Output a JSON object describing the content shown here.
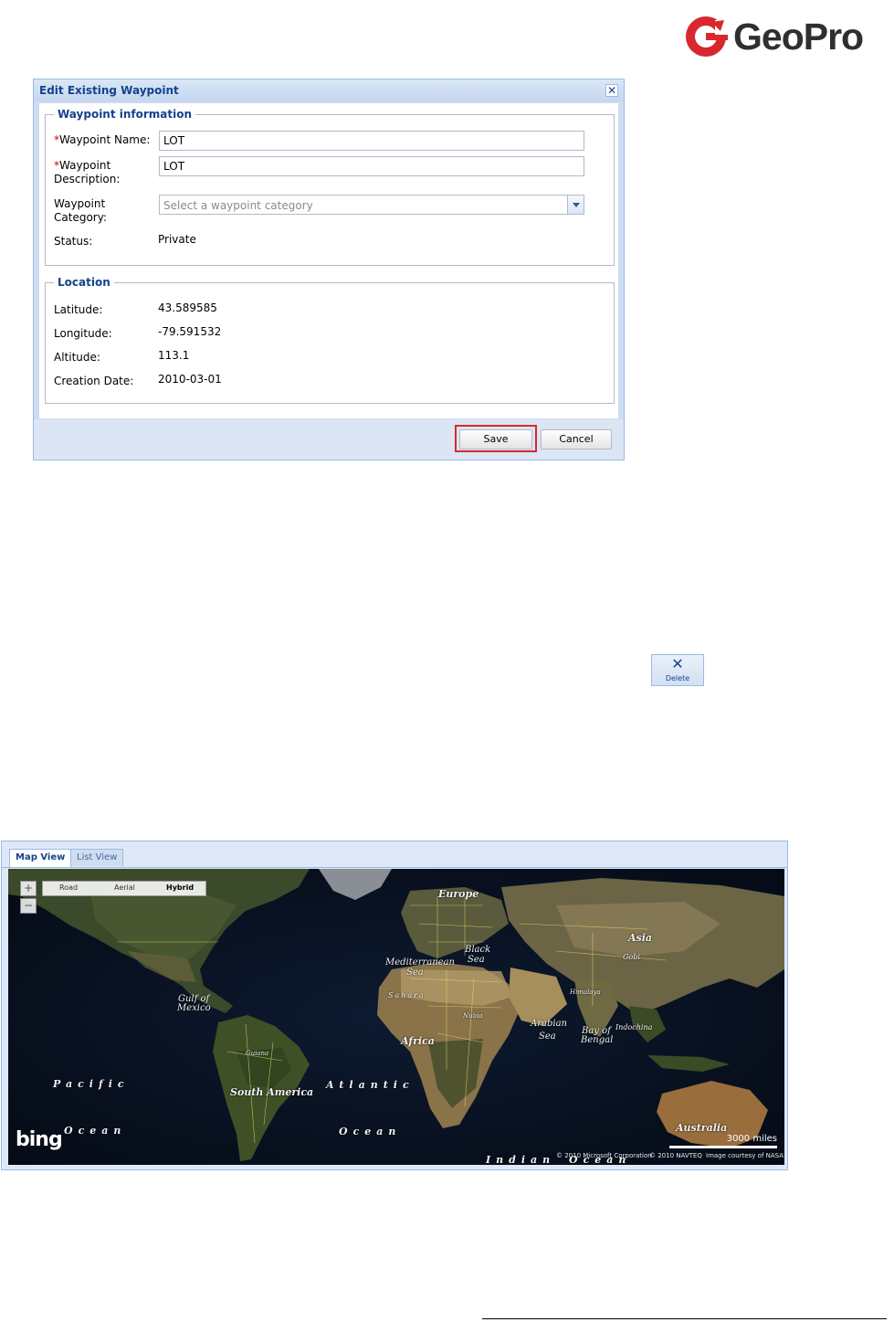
{
  "logo": {
    "text": "GeoPro",
    "color": "#d9272e"
  },
  "dialog": {
    "title": "Edit Existing Waypoint",
    "close_icon": "close-icon",
    "waypoint_section": {
      "legend": "Waypoint information",
      "name_label": "Waypoint Name:",
      "name_value": "LOT",
      "desc_label_1": "Waypoint",
      "desc_label_2": "Description:",
      "desc_value": "LOT",
      "cat_label_1": "Waypoint",
      "cat_label_2": "Category:",
      "cat_placeholder": "Select a waypoint category",
      "status_label": "Status:",
      "status_value": "Private"
    },
    "location_section": {
      "legend": "Location",
      "latitude_label": "Latitude:",
      "latitude_value": "43.589585",
      "longitude_label": "Longitude:",
      "longitude_value": "-79.591532",
      "altitude_label": "Altitude:",
      "altitude_value": "113.1",
      "date_label": "Creation Date:",
      "date_value": "2010-03-01"
    },
    "save_label": "Save",
    "cancel_label": "Cancel",
    "highlight_color": "#d9272e"
  },
  "delete_button": {
    "icon": "x-icon",
    "label": "Delete"
  },
  "map_panel": {
    "tabs": [
      {
        "label": "Map View",
        "active": true
      },
      {
        "label": "List View",
        "active": false
      }
    ],
    "map_styles": {
      "road": "Road",
      "aerial": "Aerial",
      "hybrid": "Hybrid",
      "selected": "Hybrid"
    },
    "zoom_in": "+",
    "zoom_out": "−",
    "labels": {
      "europe": "Europe",
      "asia": "Asia",
      "gobi": "Gobi",
      "black_sea_1": "Black",
      "black_sea_2": "Sea",
      "med_1": "Mediterranean",
      "med_2": "Sea",
      "sahara": "Sahara",
      "himalaya": "Himalaya",
      "nubia": "Nubia",
      "gulf_1": "Gulf of",
      "gulf_2": "Mexico",
      "africa": "Africa",
      "arabian_1": "Arabian",
      "arabian_2": "Sea",
      "bengal_1": "Bay of",
      "bengal_2": "Bengal",
      "indochina": "Indochina",
      "guiana": "Guiana",
      "south_america": "South America",
      "pacific": "Pacific",
      "atlantic": "Atlantic",
      "ocean_1": "Ocean",
      "ocean_2": "Ocean",
      "indian": "Indian",
      "indian_ocean": "Ocean",
      "australia": "Australia"
    },
    "bing_logo": "bing",
    "scale_label": "3000 miles",
    "copyright_1": "© 2010 Microsoft Corporation",
    "copyright_2": "© 2010 NAVTEQ",
    "copyright_3": "Image courtesy of NASA"
  }
}
